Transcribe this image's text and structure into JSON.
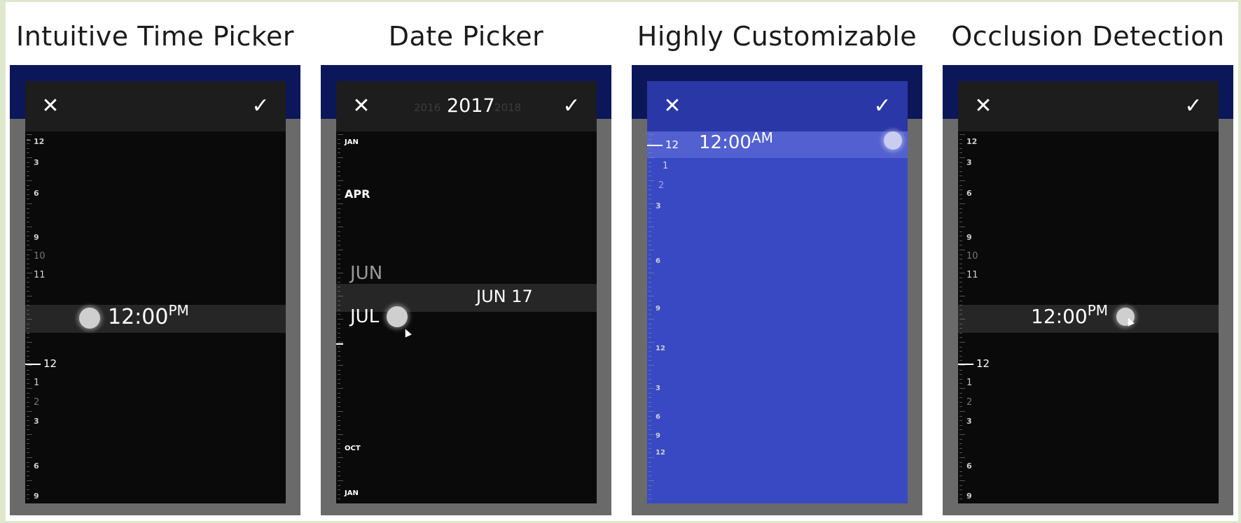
{
  "titles": [
    "Intuitive Time Picker",
    "Date Picker",
    "Highly Customizable",
    "Occlusion Detection"
  ],
  "header": {
    "close_icon": "close-icon",
    "check_icon": "check-icon"
  },
  "panel1": {
    "time": "12:00",
    "ampm": "PM",
    "current_tick": "12",
    "labels": [
      "12",
      "3",
      "6",
      "9",
      "10",
      "11",
      "1",
      "2",
      "3",
      "6",
      "9",
      "12"
    ]
  },
  "panel2": {
    "years": {
      "prev": "2016",
      "current": "2017",
      "next": "2018"
    },
    "months": [
      "JAN",
      "APR",
      "JUN",
      "JUL",
      "OCT",
      "JAN"
    ],
    "selected": "JUN 17"
  },
  "panel3": {
    "time": "12:00",
    "ampm": "AM",
    "current_tick": "12",
    "labels": [
      "1",
      "2",
      "3",
      "6",
      "9",
      "12",
      "3",
      "6",
      "9",
      "12"
    ],
    "accent": "#3949c4"
  },
  "panel4": {
    "time": "12:00",
    "ampm": "PM",
    "current_tick": "12",
    "labels": [
      "12",
      "3",
      "6",
      "9",
      "10",
      "11",
      "1",
      "2",
      "3",
      "6",
      "9",
      "12"
    ]
  }
}
